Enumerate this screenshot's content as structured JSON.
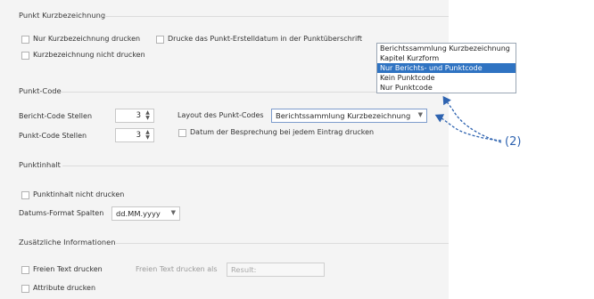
{
  "groups": {
    "punkt_kurz": {
      "title": "Punkt Kurzbezeichnung",
      "nur_kurz": "Nur Kurzbezeichnung drucken",
      "erstelldatum": "Drucke das Punkt-Erstelldatum in der Punktüberschrift",
      "nicht_drucken": "Kurzbezeichnung nicht drucken"
    },
    "punkt_code": {
      "title": "Punkt-Code",
      "bericht_label": "Bericht-Code Stellen",
      "bericht_value": "3",
      "punkt_label": "Punkt-Code Stellen",
      "punkt_value": "3",
      "layout_label": "Layout des Punkt-Codes",
      "layout_value": "Berichtssammlung Kurzbezeichnung",
      "datum_label": "Datum der Besprechung bei jedem Eintrag drucken"
    },
    "punktinhalt": {
      "title": "Punktinhalt",
      "nicht_drucken": "Punktinhalt nicht drucken",
      "datum_label": "Datums-Format Spalten",
      "datum_value": "dd.MM.yyyy"
    },
    "zusatz": {
      "title": "Zusätzliche Informationen",
      "freien_text": "Freien Text drucken",
      "freien_als_label": "Freien Text drucken als",
      "result_value": "Result:",
      "attribute": "Attribute drucken"
    }
  },
  "dropdown": {
    "options": [
      {
        "label": "Berichtssammlung Kurzbezeichnung",
        "selected": false
      },
      {
        "label": "Kapitel Kurzform",
        "selected": false
      },
      {
        "label": "Nur Berichts- und Punktcode",
        "selected": true
      },
      {
        "label": "Kein Punktcode",
        "selected": false
      },
      {
        "label": "Nur Punktcode",
        "selected": false
      }
    ]
  },
  "callout": {
    "label": "(2)"
  },
  "colors": {
    "accent": "#2f73c2",
    "callout": "#2e63b0"
  },
  "icons": {
    "spin": "spin-arrows-icon",
    "chevron": "chevron-down-icon",
    "arrow": "dashed-arrow-icon"
  }
}
